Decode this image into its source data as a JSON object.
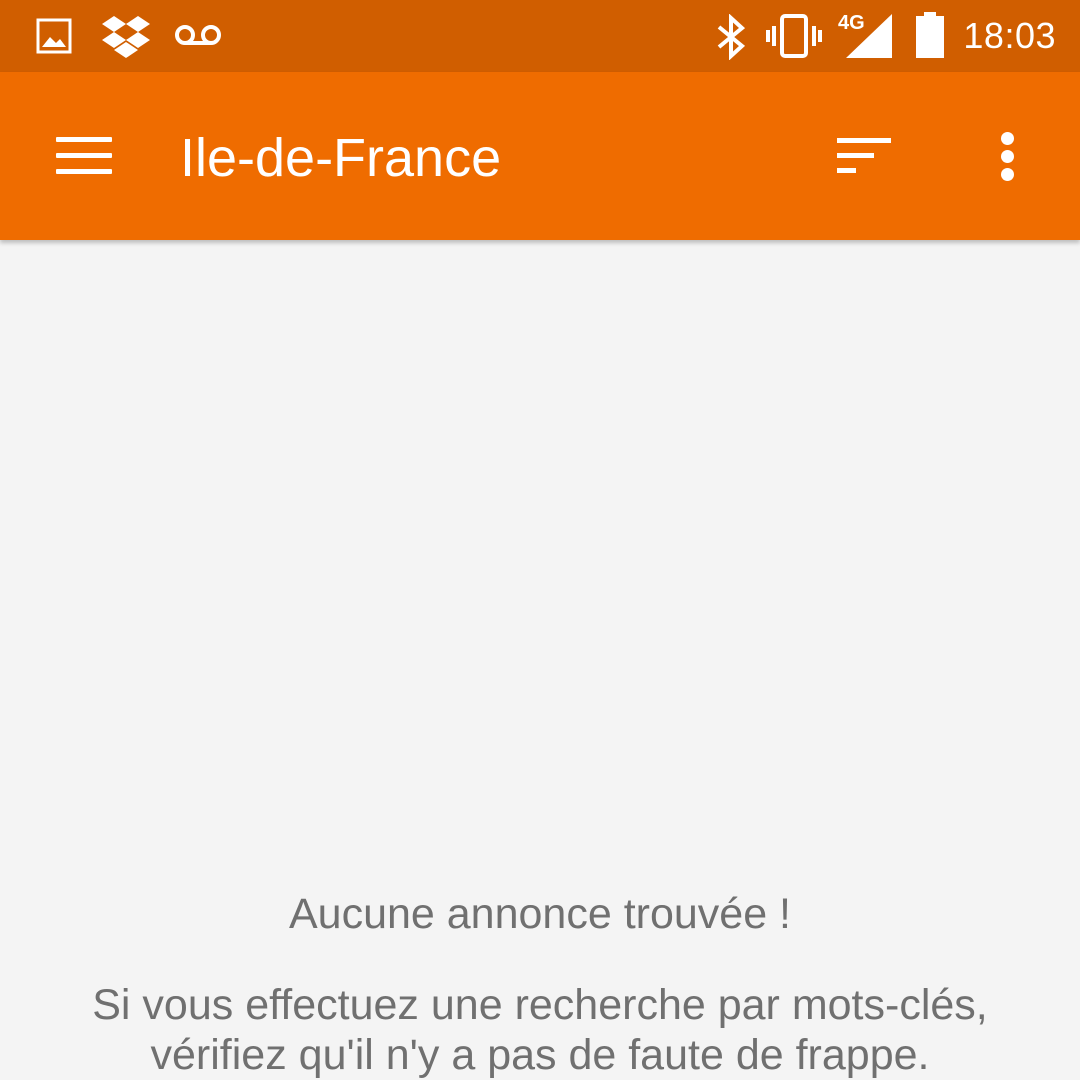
{
  "status_bar": {
    "time": "18:03",
    "network_label": "4G",
    "left_icons": [
      "gallery-icon",
      "dropbox-icon",
      "voicemail-icon"
    ],
    "right_icons": [
      "bluetooth-icon",
      "vibrate-icon",
      "signal-icon",
      "battery-icon"
    ],
    "background_color": "#d05e00"
  },
  "app_bar": {
    "title": "Ile-de-France",
    "menu_icon": "hamburger-menu-icon",
    "sort_icon": "sort-icon",
    "more_icon": "more-vert-icon",
    "background_color": "#ef6c00"
  },
  "empty_state": {
    "title": "Aucune annonce trouvée !",
    "message": "Si vous effectuez une recherche par mots-clés, vérifiez qu'il n'y a pas de faute de frappe."
  }
}
